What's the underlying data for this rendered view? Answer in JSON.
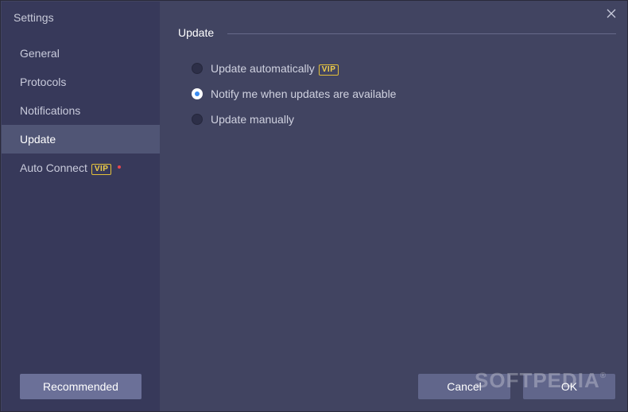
{
  "window": {
    "title": "Settings"
  },
  "sidebar": {
    "items": [
      {
        "label": "General",
        "active": false
      },
      {
        "label": "Protocols",
        "active": false
      },
      {
        "label": "Notifications",
        "active": false
      },
      {
        "label": "Update",
        "active": true
      },
      {
        "label": "Auto Connect",
        "active": false,
        "badge": "VIP",
        "dot": true
      }
    ],
    "recommended_label": "Recommended"
  },
  "update": {
    "section_title": "Update",
    "options": [
      {
        "label": "Update automatically",
        "badge": "VIP",
        "checked": false
      },
      {
        "label": "Notify me when updates are available",
        "checked": true
      },
      {
        "label": "Update manually",
        "checked": false
      }
    ]
  },
  "footer": {
    "cancel_label": "Cancel",
    "ok_label": "OK"
  },
  "watermark": {
    "text": "SOFTPEDIA",
    "mark": "®"
  },
  "colors": {
    "sidebar_bg": "#37395a",
    "content_bg": "#414461",
    "active_item_bg": "#505575",
    "vip": "#f0cf4a",
    "radio_accent": "#3a8bf0",
    "dot": "#e9474f"
  },
  "icons": {
    "close": "close-icon"
  }
}
